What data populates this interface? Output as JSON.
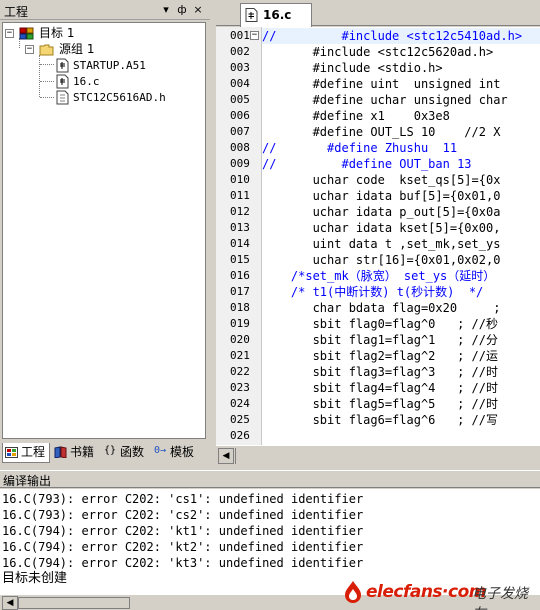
{
  "project_panel": {
    "title": "工程",
    "pin_label": "▾",
    "autohide_label": "ф",
    "close_label": "×",
    "tree": {
      "target": "目标 1",
      "group": "源组 1",
      "files": [
        "STARTUP.A51",
        "16.c",
        "STC12C5616AD.h"
      ]
    },
    "tabs": [
      {
        "label": "工程",
        "icon": "project-icon"
      },
      {
        "label": "书籍",
        "icon": "books-icon"
      },
      {
        "label": "函数",
        "icon": "functions-icon"
      },
      {
        "label": "模板",
        "icon": "templates-icon"
      }
    ]
  },
  "editor": {
    "tab_label": "16.c",
    "lines": [
      {
        "n": "001",
        "text": "//         #include <stc12c5410ad.h>"
      },
      {
        "n": "002",
        "text": "       #include <stc12c5620ad.h>"
      },
      {
        "n": "003",
        "text": "       #include <stdio.h>"
      },
      {
        "n": "004",
        "text": "       #define uint  unsigned int"
      },
      {
        "n": "005",
        "text": "       #define uchar unsigned char"
      },
      {
        "n": "006",
        "text": "       #define x1    0x3e8"
      },
      {
        "n": "007",
        "text": "       #define OUT_LS 10    //2 X"
      },
      {
        "n": "008",
        "text": "//       #define Zhushu  11"
      },
      {
        "n": "009",
        "text": "//         #define OUT_ban 13"
      },
      {
        "n": "010",
        "text": "       uchar code  kset_qs[5]={0x"
      },
      {
        "n": "011",
        "text": "       uchar idata buf[5]={0x01,0"
      },
      {
        "n": "012",
        "text": "       uchar idata p_out[5]={0x0a"
      },
      {
        "n": "013",
        "text": "       uchar idata kset[5]={0x00,"
      },
      {
        "n": "014",
        "text": "       uint data t ,set_mk,set_ys"
      },
      {
        "n": "015",
        "text": "       uchar str[16]={0x01,0x02,0"
      },
      {
        "n": "016",
        "text": "    /*set_mk（脉宽） set_ys（延时）"
      },
      {
        "n": "017",
        "text": "    /* t1(中断计数) t(秒计数)  */"
      },
      {
        "n": "018",
        "text": "       char bdata flag=0x20     ;"
      },
      {
        "n": "019",
        "text": "       sbit flag0=flag^0   ; //秒"
      },
      {
        "n": "020",
        "text": "       sbit flag1=flag^1   ; //分"
      },
      {
        "n": "021",
        "text": "       sbit flag2=flag^2   ; //运"
      },
      {
        "n": "022",
        "text": "       sbit flag3=flag^3   ; //时"
      },
      {
        "n": "023",
        "text": "       sbit flag4=flag^4   ; //时"
      },
      {
        "n": "024",
        "text": "       sbit flag5=flag^5   ; //时"
      },
      {
        "n": "025",
        "text": "       sbit flag6=flag^6   ; //写"
      },
      {
        "n": "026",
        "text": ""
      }
    ]
  },
  "output": {
    "title": "编译输出",
    "lines": [
      "16.C(793): error C202: 'cs1': undefined identifier",
      "16.C(793): error C202: 'cs2': undefined identifier",
      "16.C(794): error C202: 'kt1': undefined identifier",
      "16.C(794): error C202: 'kt2': undefined identifier",
      "16.C(794): error C202: 'kt3': undefined identifier"
    ],
    "status": "目标未创建"
  },
  "watermark": {
    "brand": "elecfans·com",
    "brand_cn": "电子发烧友"
  },
  "colors": {
    "comment": "#0000ff",
    "watermark_red": "#d81e06",
    "highlight": "#e8f2ff"
  }
}
